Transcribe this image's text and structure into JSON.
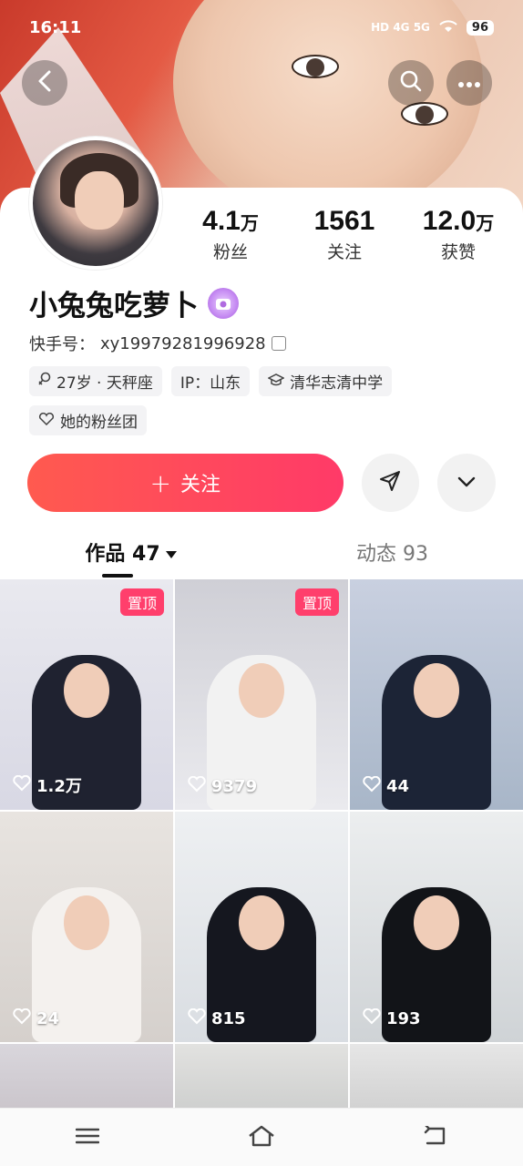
{
  "status_bar": {
    "time": "16:11",
    "indicators": "HD 4G 5G",
    "battery": "96"
  },
  "header": {
    "back_icon": "chevron-left-icon",
    "search_icon": "search-icon",
    "more_icon": "more-dots-icon"
  },
  "profile": {
    "name": "小兔兔吃萝卜",
    "uid_label": "快手号：",
    "uid": "xy19979281996928",
    "stats": [
      {
        "value": "4.1",
        "unit": "万",
        "label": "粉丝"
      },
      {
        "value": "1561",
        "unit": "",
        "label": "关注"
      },
      {
        "value": "12.0",
        "unit": "万",
        "label": "获赞"
      }
    ],
    "tags": [
      {
        "icon": "female-icon",
        "text": "27岁 · 天秤座"
      },
      {
        "icon": "",
        "text": "IP：山东"
      },
      {
        "icon": "graduation-cap-icon",
        "text": "清华志清中学"
      },
      {
        "icon": "heart-outline-icon",
        "text": "她的粉丝团"
      }
    ]
  },
  "actions": {
    "follow_label": "关注",
    "follow_prefix": "+",
    "share_icon": "send-icon",
    "expand_icon": "chevron-down-icon"
  },
  "tabs": [
    {
      "label": "作品 47",
      "active": true
    },
    {
      "label": "动态 93",
      "active": false
    }
  ],
  "posts": [
    {
      "likes": "1.2万",
      "pinned": "置顶"
    },
    {
      "likes": "9379",
      "pinned": "置顶"
    },
    {
      "likes": "44",
      "pinned": ""
    },
    {
      "likes": "24",
      "pinned": ""
    },
    {
      "likes": "815",
      "pinned": ""
    },
    {
      "likes": "193",
      "pinned": ""
    }
  ],
  "colors": {
    "follow_start": "#ff5a4f",
    "follow_end": "#ff3a68",
    "pin_badge": "#ff3f6c"
  },
  "navbar": {
    "menu_icon": "menu-icon",
    "home_icon": "home-icon",
    "back_icon": "back-arrow-icon"
  }
}
